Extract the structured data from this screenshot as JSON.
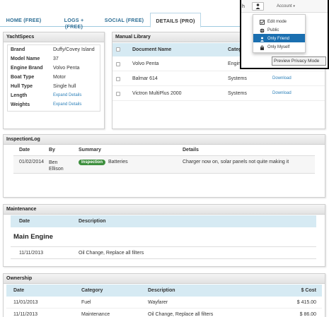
{
  "tabs": [
    {
      "label": "HOME (FREE)"
    },
    {
      "label": "LOGS + (FREE)"
    },
    {
      "label": "SOCIAL (FREE)"
    },
    {
      "label": "DETAILS (PRO)"
    }
  ],
  "specs": {
    "title": "YachtSpecs",
    "rows": [
      {
        "label": "Brand",
        "value": "Duffy/Covey Island"
      },
      {
        "label": "Model Name",
        "value": "37"
      },
      {
        "label": "Engine Brand",
        "value": "Volvo Penta"
      },
      {
        "label": "Boat Type",
        "value": "Motor"
      },
      {
        "label": "Hull Type",
        "value": "Single hull"
      },
      {
        "label": "Length",
        "value": "Expand Details"
      },
      {
        "label": "Weights",
        "value": "Expand Details"
      }
    ]
  },
  "manual": {
    "title": "Manual Library",
    "col_document": "Document Name",
    "col_category": "Categ",
    "rows": [
      {
        "name": "Volvo Penta",
        "category": "Engin",
        "action": ""
      },
      {
        "name": "Balmar 614",
        "category": "Systems",
        "action": "Download"
      },
      {
        "name": "Victron MultiPlus 2000",
        "category": "Systems",
        "action": "Download"
      }
    ]
  },
  "inspection": {
    "title": "InspectionLog",
    "headers": {
      "date": "Date",
      "by": "By",
      "summary": "Summary",
      "details": "Details"
    },
    "row": {
      "date": "01/02/2014",
      "by": "Ben Ellison",
      "badge": "Inspection",
      "summary": "Batteries",
      "details": "Charger now on, solar panels not quite making it"
    }
  },
  "maintenance": {
    "title": "Maintenance",
    "headers": {
      "date": "Date",
      "description": "Description"
    },
    "group": "Main Engine",
    "row": {
      "date": "11/11/2013",
      "description": "Oil Change, Replace all filters"
    }
  },
  "ownership": {
    "title": "Ownership",
    "headers": {
      "date": "Date",
      "category": "Category",
      "description": "Description",
      "cost": "$ Cost"
    },
    "rows": [
      {
        "date": "11/01/2013",
        "category": "Fuel",
        "description": "Wayfarer",
        "cost": "$ 415.00"
      },
      {
        "date": "11/11/2013",
        "category": "Maintenance",
        "description": "Oil Change, Replace all filters",
        "cost": "$ 86.00"
      }
    ]
  },
  "popup": {
    "partial_text": "h",
    "account_label": "Account",
    "menu": [
      {
        "label": "Edit mode",
        "icon": "pencil-check-icon"
      },
      {
        "label": "Public",
        "icon": "globe-icon"
      },
      {
        "label": "Only Friend",
        "icon": "person-icon",
        "selected": true
      },
      {
        "label": "Only Myself",
        "icon": "lock-icon"
      }
    ],
    "tooltip": "Preview Privacy Mode"
  },
  "colors": {
    "accent": "#2d6e95",
    "link": "#2d80b9",
    "selected": "#1a6fb0",
    "badge": "#3e8f3e",
    "header_blue": "#d6eaf3"
  }
}
